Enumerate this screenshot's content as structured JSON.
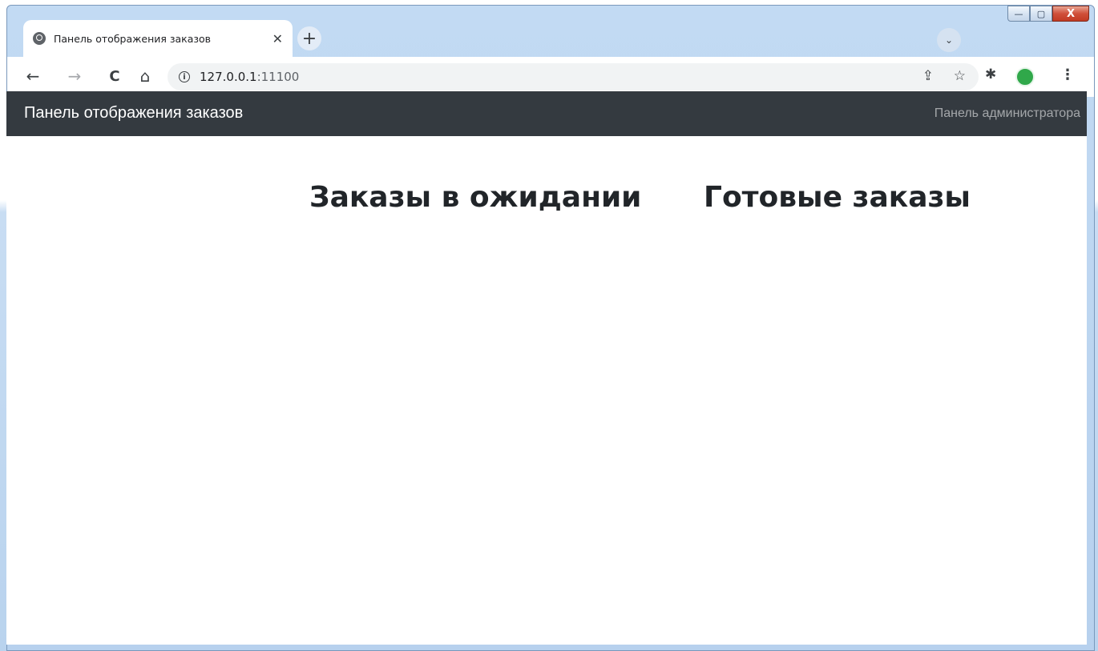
{
  "browser": {
    "tab": {
      "title": "Панель отображения заказов",
      "close_glyph": "✕"
    },
    "new_tab_glyph": "+",
    "tab_search_glyph": "⌄",
    "nav": {
      "back": "←",
      "forward": "→",
      "reload": "C",
      "home": "⌂"
    },
    "address": {
      "host": "127.0.0.1",
      "port": ":11100",
      "info_glyph": "i"
    },
    "share_glyph": "⇪",
    "star_glyph": "☆",
    "extensions_glyph": "✱",
    "menu_glyph": "⋮",
    "window_controls": {
      "minimize": "—",
      "maximize": "▢",
      "close": "X"
    }
  },
  "navbar": {
    "brand": "Панель отображения заказов",
    "admin_link": "Панель администратора"
  },
  "main": {
    "pending_heading": "Заказы в ожидании",
    "ready_heading": "Готовые заказы"
  },
  "colors": {
    "navbar_bg": "#343a40",
    "heading_text": "#212529",
    "profile_avatar": "#30a84a"
  }
}
